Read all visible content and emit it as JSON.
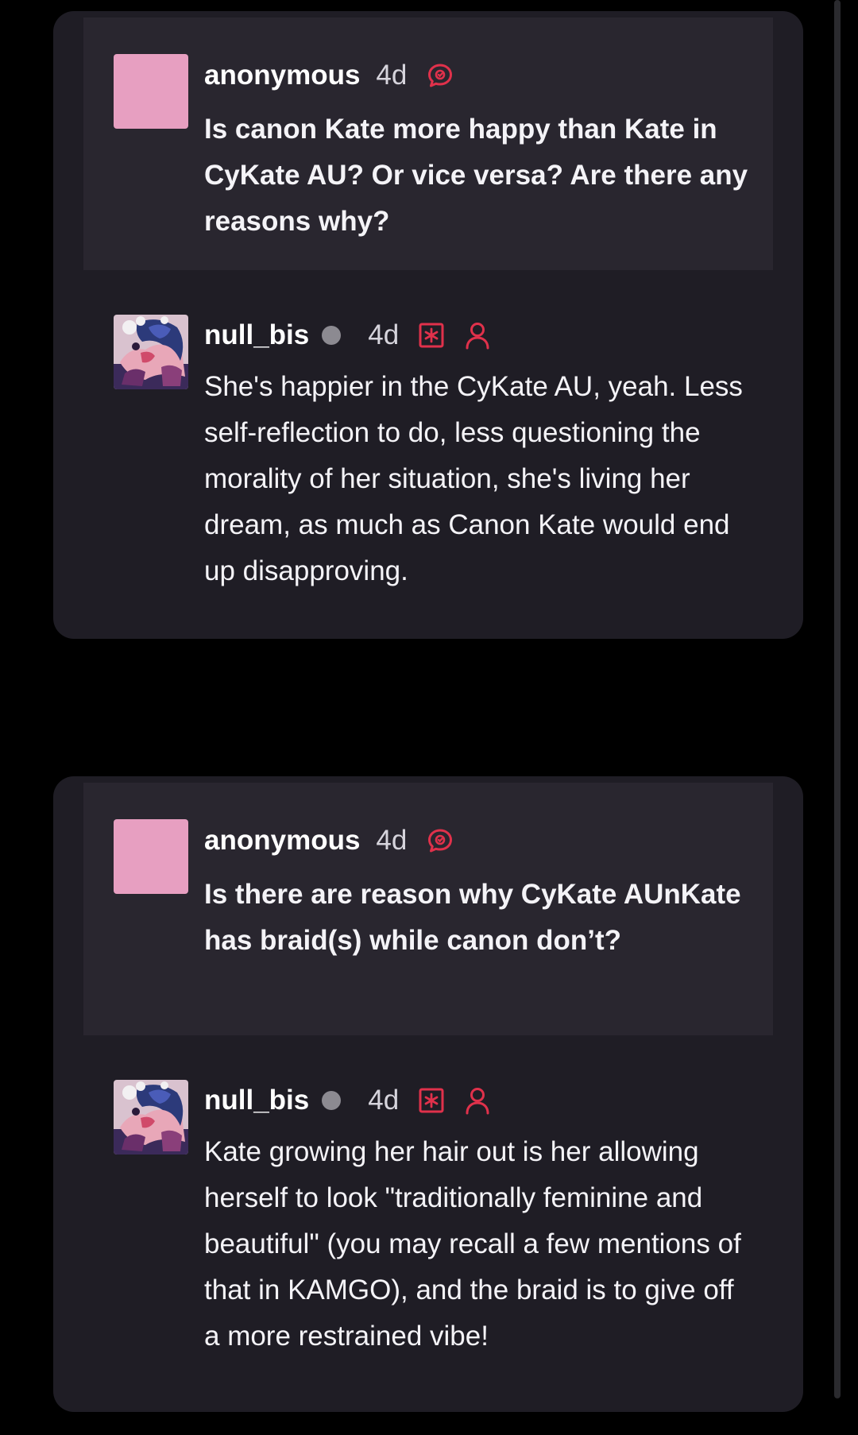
{
  "colors": {
    "page_background": "#000000",
    "card_background": "#1f1d25",
    "ask_background": "#29262f",
    "anon_avatar": "#e79fc1",
    "accent_red": "#e0314b",
    "status_dot": "#8c8a91"
  },
  "posts": [
    {
      "ask": {
        "username": "anonymous",
        "time": "4d",
        "icon": "speech-bubble-icon",
        "text": "Is canon Kate more happy than Kate in CyKate AU? Or vice versa? Are there any reasons why?"
      },
      "answer": {
        "username": "null_bis",
        "time": "4d",
        "icons": [
          "asterisk-box-icon",
          "person-icon"
        ],
        "text": "She's happier in the CyKate AU, yeah. Less self-reflection to do, less questioning the morality of her situation, she's living her dream, as much as Canon Kate would end up disapproving."
      }
    },
    {
      "ask": {
        "username": "anonymous",
        "time": "4d",
        "icon": "speech-bubble-icon",
        "text": "Is there are reason why CyKate AUnKate has braid(s) while canon don’t?"
      },
      "answer": {
        "username": "null_bis",
        "time": "4d",
        "icons": [
          "asterisk-box-icon",
          "person-icon"
        ],
        "text": "Kate growing her hair out is her allowing herself to look \"traditionally feminine and beautiful\" (you may recall a few mentions of that in KAMGO), and the braid is to give off a more restrained vibe!"
      }
    }
  ]
}
